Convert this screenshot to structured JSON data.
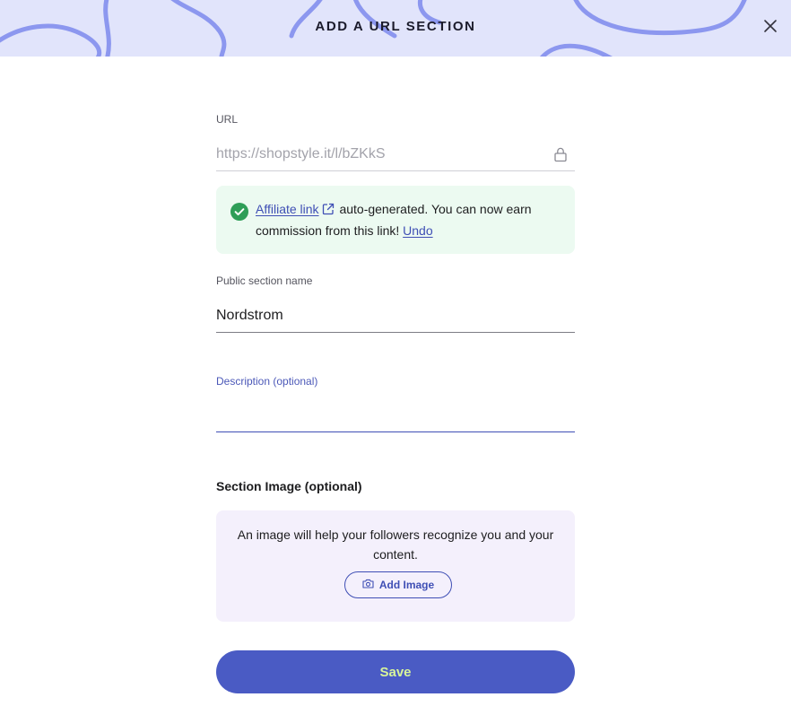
{
  "header": {
    "title": "ADD A URL SECTION",
    "close_icon": "close-icon"
  },
  "url": {
    "label": "URL",
    "placeholder": "https://shopstyle.it/l/bZKkS",
    "lock_icon": "lock-icon"
  },
  "notice": {
    "check_icon": "check-circle-icon",
    "link_text": "Affiliate link",
    "link_icon": "external-link-icon",
    "text_1": " auto-generated. You can now earn commission from this link! ",
    "undo": "Undo"
  },
  "section_name": {
    "label": "Public section name",
    "value": "Nordstrom"
  },
  "description": {
    "label": "Description (optional)",
    "value": ""
  },
  "section_image": {
    "heading": "Section Image (optional)",
    "text": "An image will help your followers recognize you and your content.",
    "button": "Add Image",
    "button_icon": "camera-icon"
  },
  "save": {
    "label": "Save"
  },
  "colors": {
    "header_bg": "#e1e4fb",
    "accent": "#4a5bc4",
    "save_text": "#d8f59a",
    "notice_bg": "#ecfaf1",
    "check": "#2f9e58",
    "image_box_bg": "#f4f0fc"
  }
}
